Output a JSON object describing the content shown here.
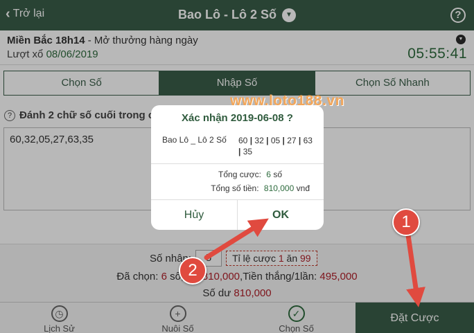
{
  "topbar": {
    "back_label": "Trở lại",
    "title": "Bao Lô - Lô 2 Số",
    "help_label": "?"
  },
  "info": {
    "region": "Miền Bắc 18h14",
    "schedule": " - Mở thưởng hàng ngày",
    "draw_label": "Lượt xổ",
    "draw_date": "08/06/2019",
    "countdown": "05:55:41"
  },
  "tabs": [
    {
      "label": "Chọn Số",
      "active": false
    },
    {
      "label": "Nhập Số",
      "active": true
    },
    {
      "label": "Chọn Số Nhanh",
      "active": false
    }
  ],
  "hint": {
    "text": "Đánh 2 chữ số cuối trong ca"
  },
  "input": {
    "value": "60,32,05,27,63,35"
  },
  "summary": {
    "so_nhan_label": "Số nhân:",
    "so_nhan_value": "5",
    "ratio_label": "Tỉ lệ cược",
    "ratio_a": "1",
    "ratio_an": "ăn",
    "ratio_b": "99",
    "da_chon_label": "Đã chọn:",
    "da_chon_count": "6",
    "da_chon_unit": "số, Số",
    "tien_value": "810,000",
    "tien_thang_label": ",Tiền thắng/1lần:",
    "tien_thang_value": "495,000",
    "so_du_label": "Số dư",
    "so_du_value": "810,000"
  },
  "bottomnav": {
    "history": "Lịch Sử",
    "nuoi_so": "Nuôi Số",
    "chon_so": "Chọn Số",
    "bet": "Đặt Cược"
  },
  "watermark": "www.loto188.vn",
  "dialog": {
    "title": "Xác nhận 2019-06-08 ?",
    "game": "Bao Lô _ Lô 2 Số",
    "numbers": [
      "60",
      "32",
      "05",
      "27",
      "63",
      "35"
    ],
    "total_bets_label": "Tổng cược:",
    "total_bets_value": "6",
    "total_bets_unit": "số",
    "total_money_label": "Tổng số tiền:",
    "total_money_value": "810,000",
    "total_money_unit": "vnđ",
    "cancel_label": "Hủy",
    "ok_label": "OK"
  },
  "annotations": {
    "badge_1": "1",
    "badge_2": "2",
    "color": "#e04a3f"
  }
}
